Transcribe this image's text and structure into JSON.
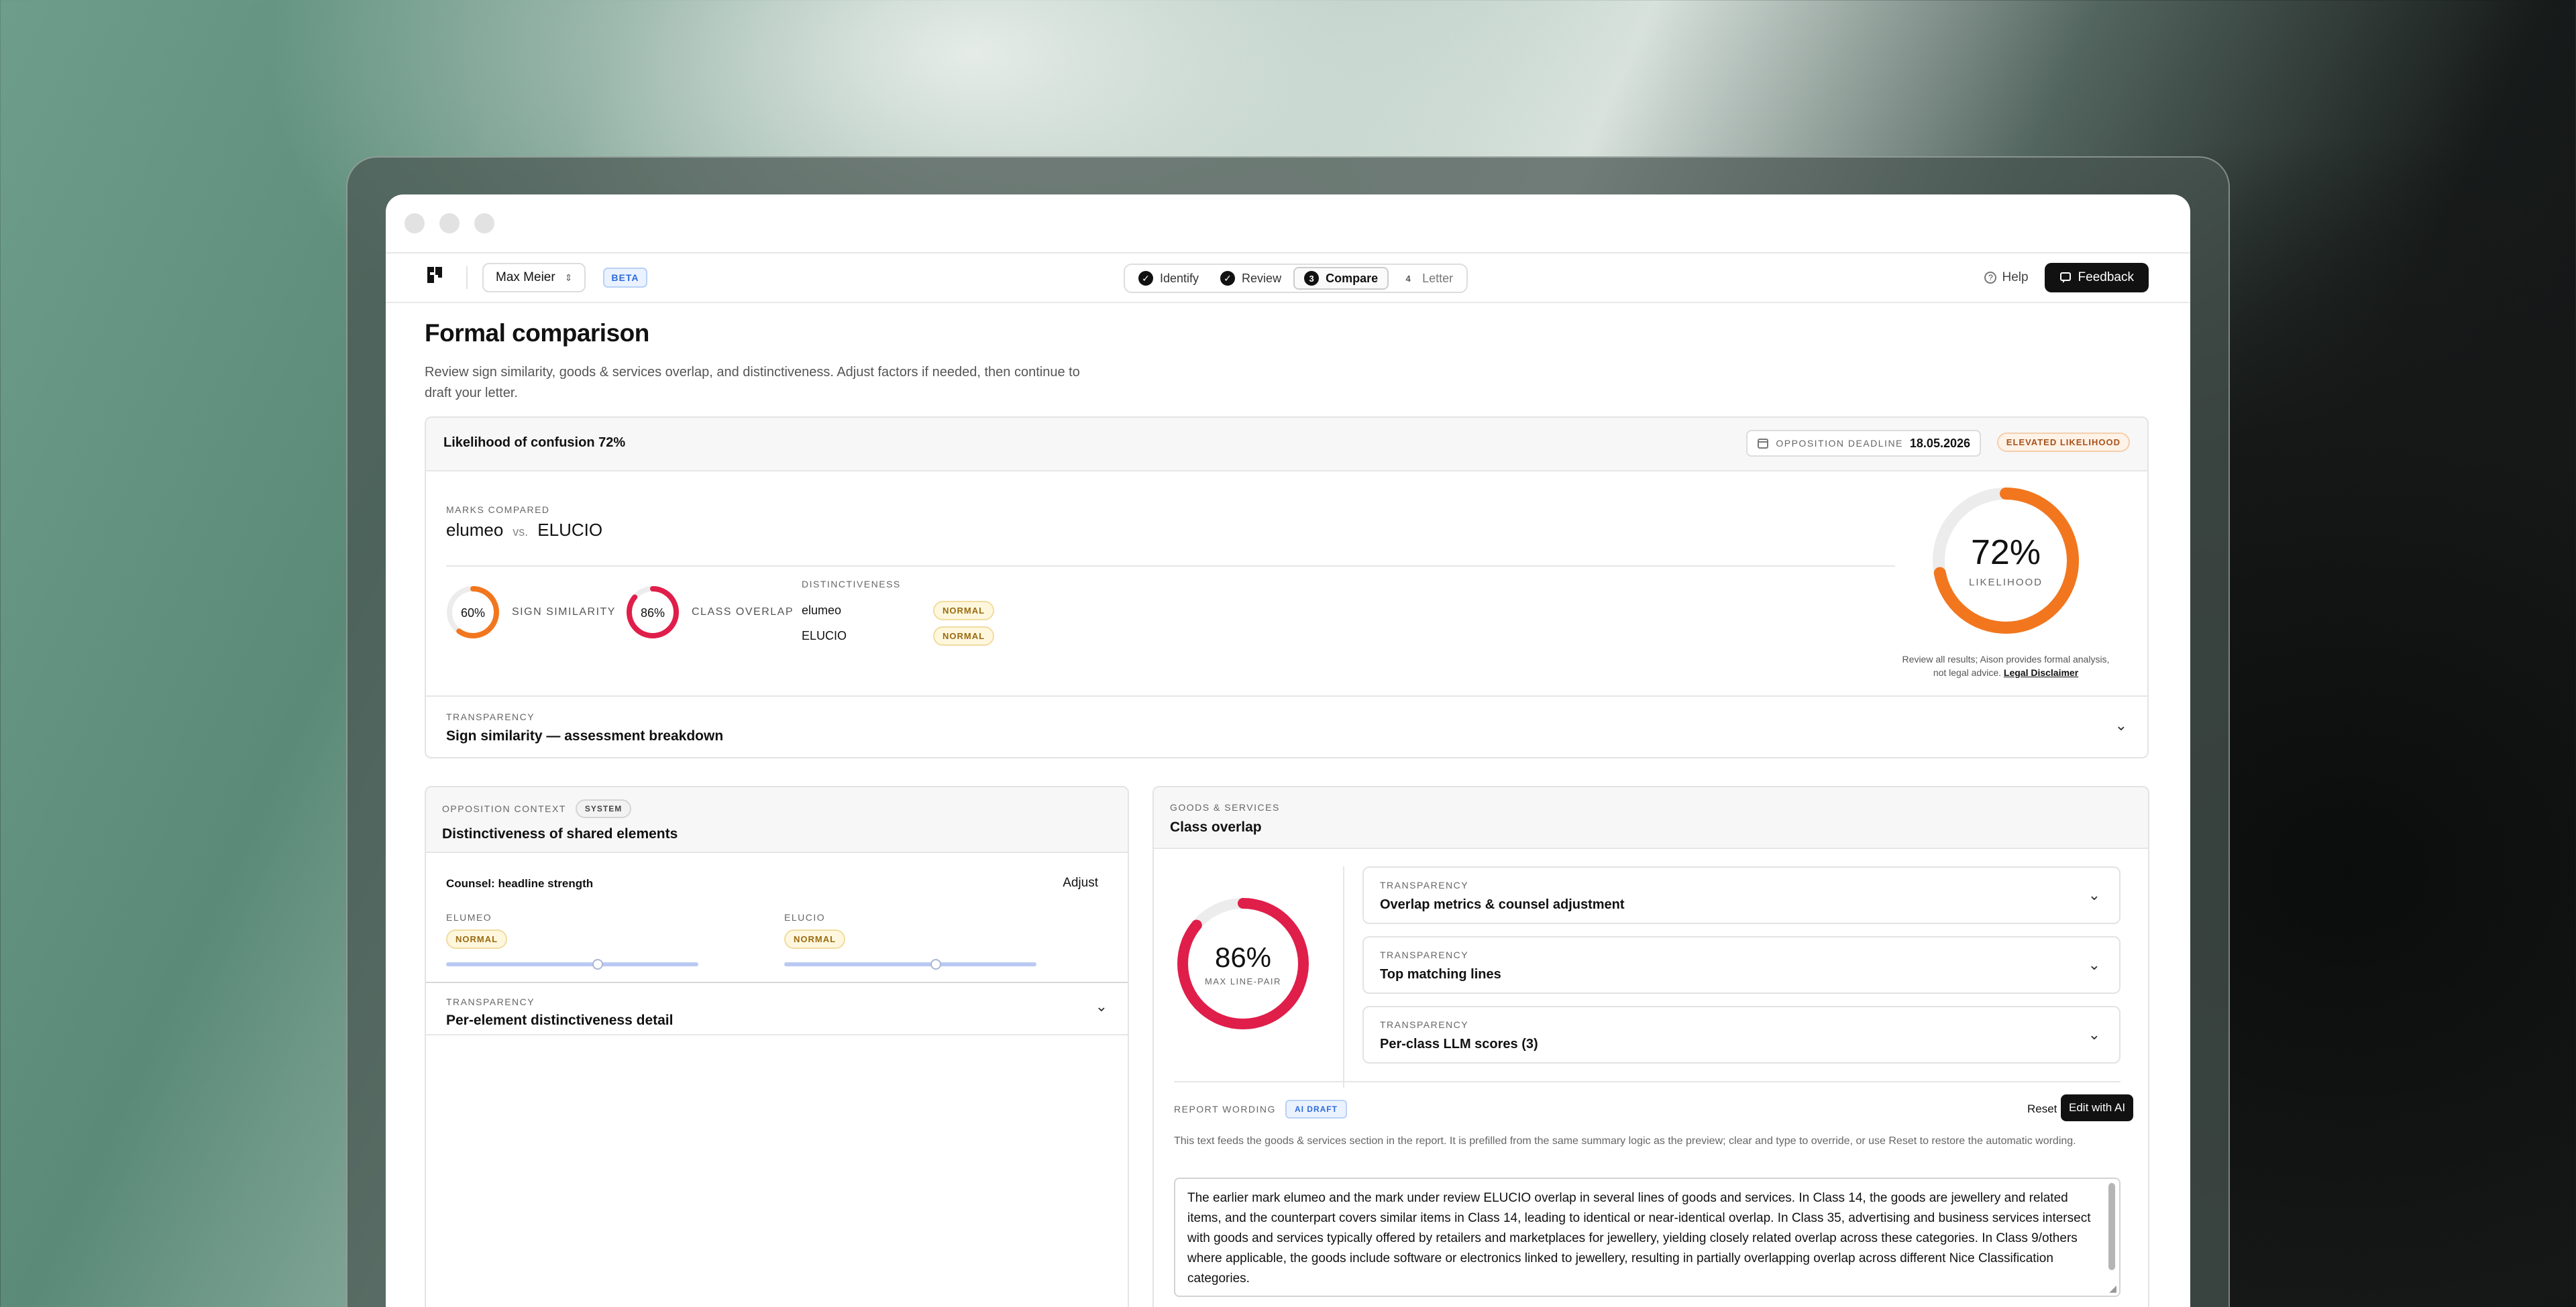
{
  "app": {
    "user": "Max Meier",
    "beta": "BETA",
    "steps": [
      {
        "label": "Identify",
        "marker": "✓"
      },
      {
        "label": "Review",
        "marker": "✓"
      },
      {
        "label": "Compare",
        "marker": "3"
      },
      {
        "label": "Letter",
        "marker": "4"
      }
    ],
    "help": "Help",
    "feedback": "Feedback"
  },
  "page": {
    "title": "Formal comparison",
    "subtitle": "Review sign similarity, goods & services overlap, and distinctiveness. Adjust factors if needed, then continue to draft your letter."
  },
  "summary": {
    "title": "Likelihood of confusion 72%",
    "deadline_label": "OPPOSITION DEADLINE",
    "deadline_value": "18.05.2026",
    "likelihood_badge": "ELEVATED LIKELIHOOD",
    "marks_label": "MARKS COMPARED",
    "mark_a": "elumeo",
    "vs": "vs.",
    "mark_b": "ELUCIO",
    "sign_similarity_value": "60%",
    "sign_similarity_fraction": 0.6,
    "sign_similarity_label": "SIGN SIMILARITY",
    "class_overlap_value": "86%",
    "class_overlap_fraction": 0.86,
    "class_overlap_label": "CLASS OVERLAP",
    "distinctiveness_label": "DISTINCTIVENESS",
    "distinct_rows": [
      {
        "mark": "elumeo",
        "level": "NORMAL"
      },
      {
        "mark": "ELUCIO",
        "level": "NORMAL"
      }
    ],
    "likelihood_value": "72%",
    "likelihood_fraction": 0.72,
    "likelihood_label": "LIKELIHOOD",
    "disclaimer": "Review all results; Aison provides formal analysis, not legal advice.",
    "disclaimer_link": "Legal Disclaimer",
    "transparency_label": "TRANSPARENCY",
    "transparency_title": "Sign similarity — assessment breakdown"
  },
  "context": {
    "eyebrow": "OPPOSITION CONTEXT",
    "badge": "SYSTEM",
    "title": "Distinctiveness of shared elements",
    "counsel": "Counsel: headline strength",
    "adjust": "Adjust",
    "left_label": "ELUMEO",
    "left_level": "NORMAL",
    "left_fraction": 0.6,
    "right_label": "ELUCIO",
    "right_level": "NORMAL",
    "right_fraction": 0.6,
    "transparency_label": "TRANSPARENCY",
    "transparency_title": "Per-element distinctiveness detail"
  },
  "goods": {
    "eyebrow": "GOODS & SERVICES",
    "title": "Class overlap",
    "ring_value": "86%",
    "ring_fraction": 0.86,
    "ring_label": "MAX LINE-PAIR",
    "accordions": [
      {
        "eyebrow": "TRANSPARENCY",
        "title": "Overlap metrics & counsel adjustment"
      },
      {
        "eyebrow": "TRANSPARENCY",
        "title": "Top matching lines"
      },
      {
        "eyebrow": "TRANSPARENCY",
        "title": "Per-class LLM scores (3)"
      }
    ],
    "report_label": "REPORT WORDING",
    "report_badge": "AI DRAFT",
    "reset": "Reset",
    "edit_ai": "Edit with AI",
    "report_help": "This text feeds the goods & services section in the report. It is prefilled from the same summary logic as the preview; clear and type to override, or use Reset to restore the automatic wording.",
    "report_text": "The earlier mark elumeo and the mark under review ELUCIO overlap in several lines of goods and services. In Class 14, the goods are jewellery and related items, and the counterpart covers similar items in Class 14, leading to identical or near-identical overlap. In Class 35, advertising and business services intersect with goods and services typically offered by retailers and marketplaces for jewellery, yielding closely related overlap across these categories. In Class 9/others where applicable, the goods include software or electronics linked to jewellery, resulting in partially overlapping overlap across different Nice Classification categories."
  },
  "colors": {
    "orange": "#f2761e",
    "red": "#e01e4a",
    "track": "#ececec"
  }
}
